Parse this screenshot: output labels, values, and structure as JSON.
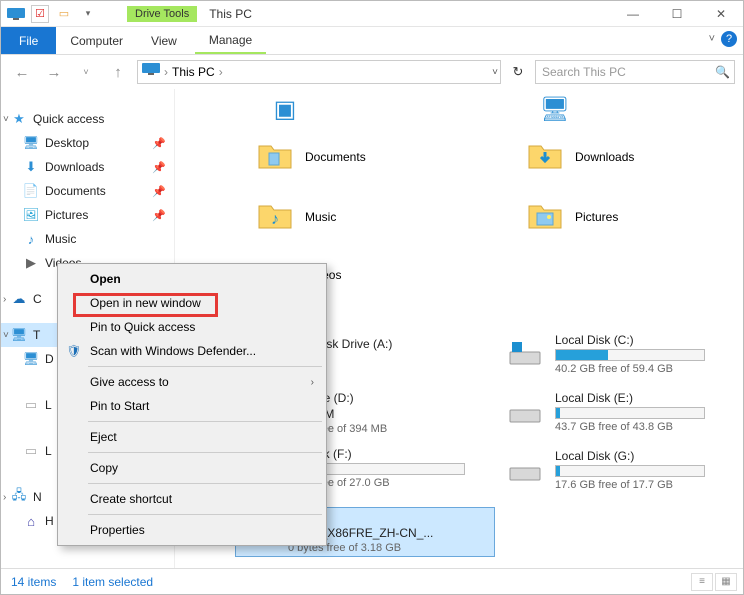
{
  "window": {
    "title": "This PC",
    "drive_tools_label": "Drive Tools"
  },
  "ribbon": {
    "file": "File",
    "tabs": [
      "Computer",
      "View"
    ],
    "drive_tab": "Manage"
  },
  "addr": {
    "path": "This PC",
    "search_placeholder": "Search This PC"
  },
  "sidebar": {
    "quick_access": "Quick access",
    "items": [
      {
        "label": "Desktop",
        "pinned": true
      },
      {
        "label": "Downloads",
        "pinned": true
      },
      {
        "label": "Documents",
        "pinned": true
      },
      {
        "label": "Pictures",
        "pinned": true
      },
      {
        "label": "Music",
        "pinned": false
      },
      {
        "label": "Videos",
        "pinned": false
      }
    ],
    "onedrive": "C",
    "this_pc": "T",
    "truncated": [
      "D",
      "L",
      "L",
      "N",
      "H"
    ]
  },
  "content": {
    "folders": [
      {
        "name": "Documents"
      },
      {
        "name": "Downloads"
      },
      {
        "name": "Music"
      },
      {
        "name": "Pictures"
      },
      {
        "name": "Videos"
      }
    ],
    "drives_left": [
      {
        "name": "Disk Drive (A:)",
        "free": ""
      },
      {
        "name": "ive (D:)",
        "sub": "OM",
        "free": "free of 394 MB"
      },
      {
        "name": "isk (F:)",
        "free": "free of 27.0 GB"
      },
      {
        "name": "ive (H:)",
        "sub": "CPBA_X86FRE_ZH-CN_...",
        "free": "0 bytes free of 3.18 GB"
      }
    ],
    "drives_right": [
      {
        "name": "Local Disk (C:)",
        "free": "40.2 GB free of 59.4 GB",
        "fill": 35
      },
      {
        "name": "Local Disk (E:)",
        "free": "43.7 GB free of 43.8 GB",
        "fill": 2
      },
      {
        "name": "Local Disk (G:)",
        "free": "17.6 GB free of 17.7 GB",
        "fill": 2
      }
    ]
  },
  "context_menu": {
    "open": "Open",
    "open_new": "Open in new window",
    "pin_quick": "Pin to Quick access",
    "defender": "Scan with Windows Defender...",
    "give_access": "Give access to",
    "pin_start": "Pin to Start",
    "eject": "Eject",
    "copy": "Copy",
    "shortcut": "Create shortcut",
    "properties": "Properties"
  },
  "status": {
    "count": "14 items",
    "selected": "1 item selected"
  }
}
